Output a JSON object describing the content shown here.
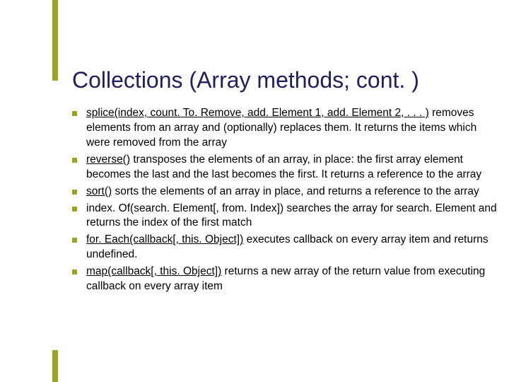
{
  "title": "Collections (Array methods; cont. )",
  "accent_color": "#9aa322",
  "title_color": "#202060",
  "bullets": [
    {
      "underlined": "splice(index, count. To. Remove, add. Element 1, add. Element 2, . . . )",
      "rest": " removes elements from an array and (optionally) replaces them. It returns the items which were removed from the array"
    },
    {
      "underlined": "reverse()",
      "rest": " transposes the elements of an array, in place: the first array element becomes the last and the last becomes the first. It returns a reference to the array"
    },
    {
      "underlined": "sort()",
      "rest": " sorts the elements of an array in place, and returns a reference to the array"
    },
    {
      "underlined": "index. Of(search. Element[, from. Index])",
      "rest": " searches the array for search. Element and returns the index of the first match"
    },
    {
      "underlined": "for. Each(callback[, this. Object])",
      "rest": " executes callback on every array item and returns undefined."
    },
    {
      "underlined": "map(callback[, this. Object])",
      "rest": " returns a new array of the return value from executing callback on every array item"
    }
  ]
}
